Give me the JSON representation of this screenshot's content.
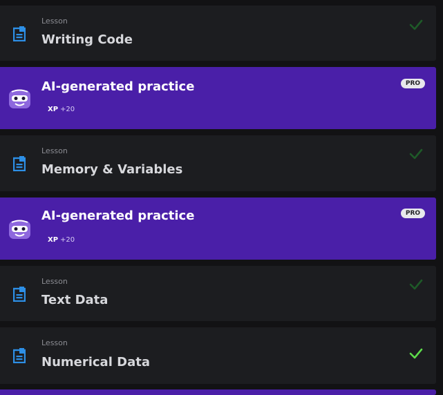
{
  "items": [
    {
      "kind": "lesson",
      "label": "Lesson",
      "title": "Writing Code",
      "completed": true,
      "check_color": "#1e5a28"
    },
    {
      "kind": "practice",
      "title": "AI-generated practice",
      "xp_label": "XP",
      "xp_value": "+20",
      "badge": "PRO"
    },
    {
      "kind": "lesson",
      "label": "Lesson",
      "title": "Memory & Variables",
      "completed": true,
      "check_color": "#1e5a28"
    },
    {
      "kind": "practice",
      "title": "AI-generated practice",
      "xp_label": "XP",
      "xp_value": "+20",
      "badge": "PRO"
    },
    {
      "kind": "lesson",
      "label": "Lesson",
      "title": "Text Data",
      "completed": true,
      "check_color": "#1e5a28"
    },
    {
      "kind": "lesson",
      "label": "Lesson",
      "title": "Numerical Data",
      "completed": true,
      "check_color": "#5ddc4a"
    }
  ],
  "colors": {
    "lesson_bg": "#1c1d20",
    "practice_bg": "#4a1fa8",
    "lesson_icon": "#2d8fe6",
    "robot_body": "#8e68de"
  },
  "icons": {
    "lesson": "document-icon",
    "practice": "robot-icon",
    "done": "check-icon"
  }
}
